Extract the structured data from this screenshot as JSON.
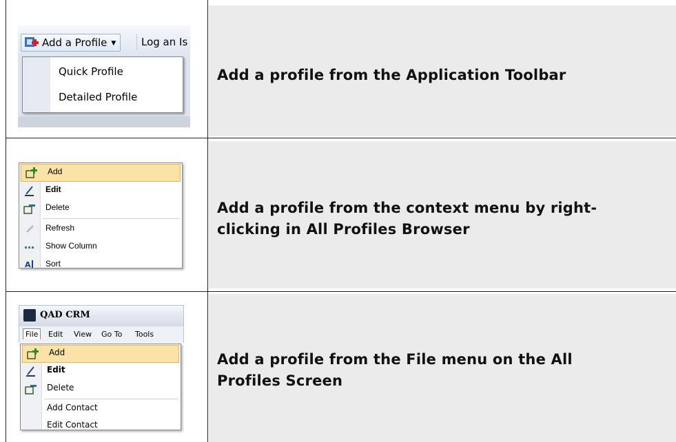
{
  "rows": [
    {
      "description": "Add a profile from the Application Toolbar",
      "screenshot": {
        "toolbar_button": "Add a Profile",
        "toolbar_next": "Log an Is",
        "dropdown_items": [
          "Quick Profile",
          "Detailed Profile"
        ]
      }
    },
    {
      "description_line1": "Add a profile from the context menu by right-",
      "description_line2": "clicking in All Profiles Browser",
      "screenshot": {
        "menu_items": [
          {
            "label": "Add",
            "icon": "add-icon"
          },
          {
            "label": "Edit",
            "icon": "edit-icon"
          },
          {
            "label": "Delete",
            "icon": "delete-icon"
          },
          {
            "label": "Refresh",
            "icon": "refresh-icon"
          },
          {
            "label": "Show Column",
            "icon": "show-column-icon"
          },
          {
            "label": "Sort",
            "icon": "sort-icon"
          }
        ]
      }
    },
    {
      "description_line1": "Add a profile from the File menu on the All",
      "description_line2": "Profiles Screen",
      "screenshot": {
        "window_title": "QAD CRM",
        "menubar": [
          "File",
          "Edit",
          "View",
          "Go To",
          "Tools"
        ],
        "menu_items": [
          {
            "label": "Add",
            "icon": "add-icon"
          },
          {
            "label": "Edit",
            "icon": "edit-icon"
          },
          {
            "label": "Delete",
            "icon": "delete-icon"
          },
          {
            "label": "Add Contact",
            "icon": ""
          },
          {
            "label": "Edit Contact",
            "icon": ""
          }
        ]
      }
    }
  ],
  "colors": {
    "cell_background": "#ebebeb",
    "menu_highlight": "#fbe3a8",
    "border": "#222222"
  }
}
